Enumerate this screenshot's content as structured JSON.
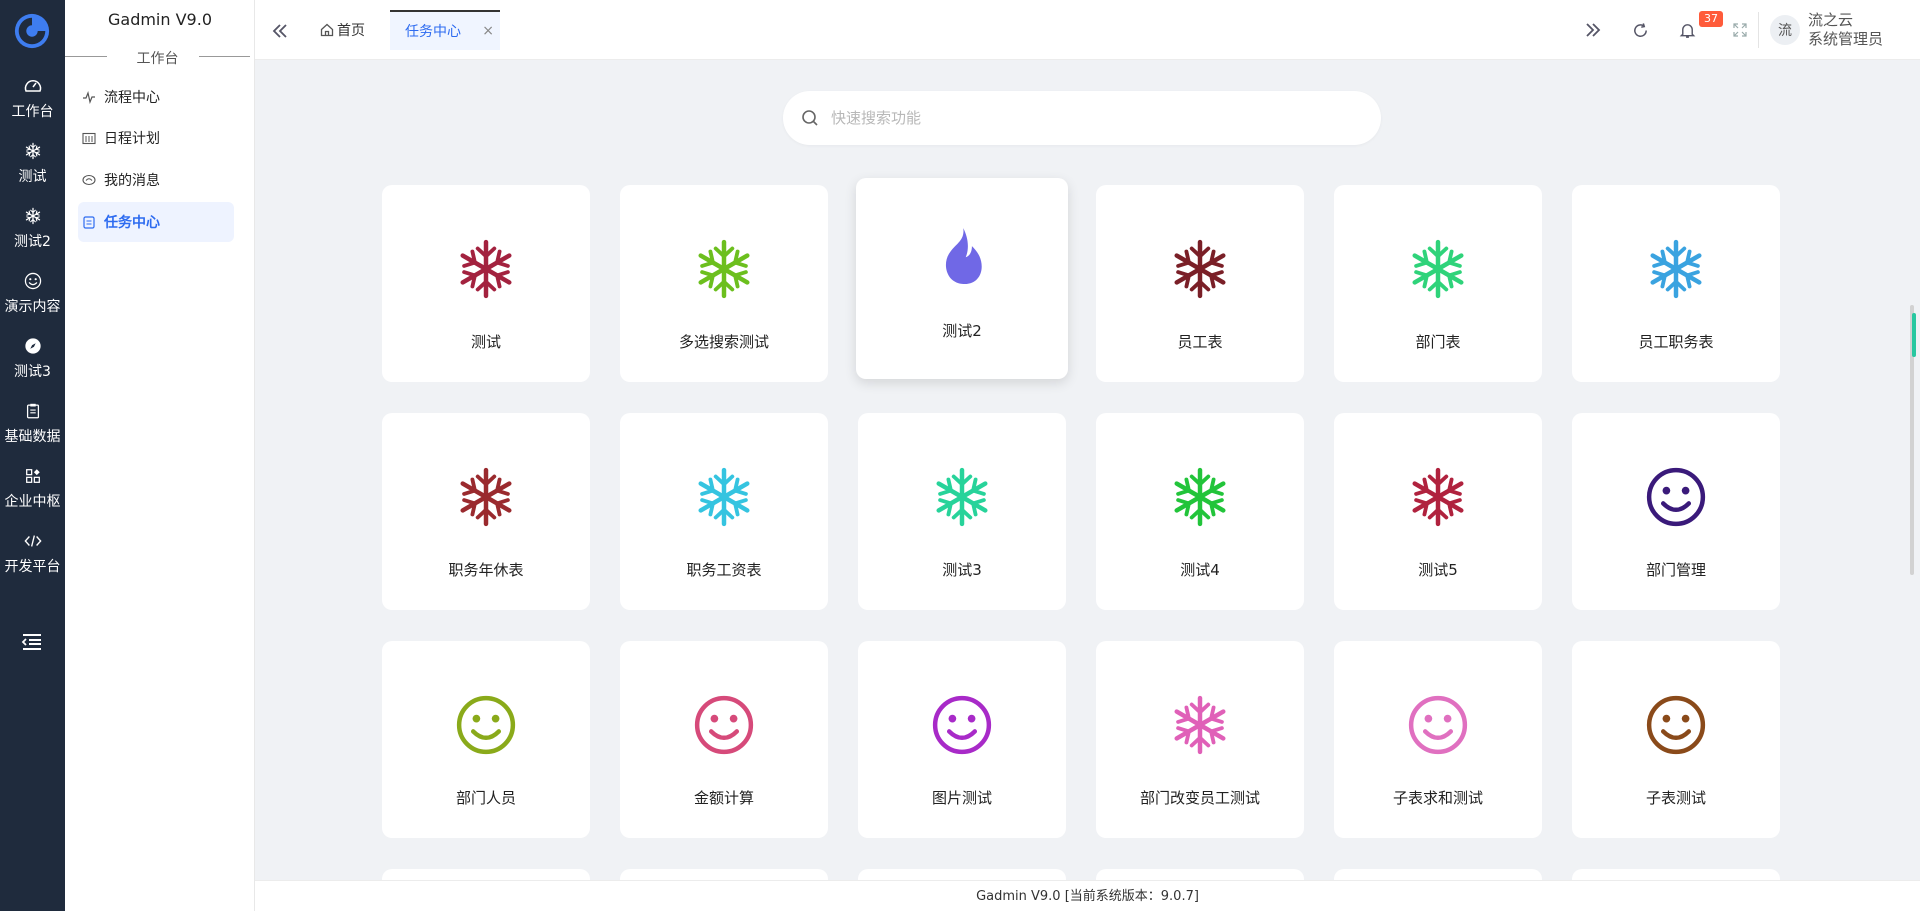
{
  "rail": {
    "items": [
      {
        "label": "工作台",
        "icon": "dashboard-icon"
      },
      {
        "label": "测试",
        "icon": "snowflake-icon"
      },
      {
        "label": "测试2",
        "icon": "snowflake-icon"
      },
      {
        "label": "演示内容",
        "icon": "smile-icon"
      },
      {
        "label": "测试3",
        "icon": "compass-icon"
      },
      {
        "label": "基础数据",
        "icon": "clipboard-icon"
      },
      {
        "label": "企业中枢",
        "icon": "apps-icon"
      },
      {
        "label": "开发平台",
        "icon": "code-icon"
      }
    ]
  },
  "sidebar": {
    "title": "Gadmin V9.0",
    "section": "工作台",
    "items": [
      {
        "label": "流程中心",
        "icon": "pulse-icon"
      },
      {
        "label": "日程计划",
        "icon": "calendar-icon"
      },
      {
        "label": "我的消息",
        "icon": "message-icon"
      },
      {
        "label": "任务中心",
        "icon": "task-icon",
        "active": true
      }
    ]
  },
  "header": {
    "tabs": [
      {
        "label": "首页"
      },
      {
        "label": "任务中心",
        "close": "×"
      }
    ],
    "notification_count": "37",
    "user": {
      "avatar_text": "流",
      "name": "流之云",
      "role": "系统管理员"
    }
  },
  "search": {
    "placeholder": "快速搜索功能"
  },
  "colors": {
    "rail_bg": "#1f2b3d",
    "accent": "#2d6bf0",
    "badge": "#ff5b3a"
  },
  "cards": [
    {
      "label": "测试",
      "icon": "snowflake-icon",
      "color": "#a3223f"
    },
    {
      "label": "多选搜索测试",
      "icon": "snowflake-icon",
      "color": "#6cbf1e"
    },
    {
      "label": "测试2",
      "icon": "fire-icon",
      "color": "#7068e6"
    },
    {
      "label": "员工表",
      "icon": "snowflake-icon",
      "color": "#7a1f27"
    },
    {
      "label": "部门表",
      "icon": "snowflake-icon",
      "color": "#2fd37a"
    },
    {
      "label": "员工职务表",
      "icon": "snowflake-icon",
      "color": "#3aa3e0"
    },
    {
      "label": "职务年休表",
      "icon": "snowflake-icon",
      "color": "#9a2a2e"
    },
    {
      "label": "职务工资表",
      "icon": "snowflake-icon",
      "color": "#35c4e0"
    },
    {
      "label": "测试3",
      "icon": "snowflake-icon",
      "color": "#27d39a"
    },
    {
      "label": "测试4",
      "icon": "snowflake-icon",
      "color": "#22c43a"
    },
    {
      "label": "测试5",
      "icon": "snowflake-icon",
      "color": "#b0223e"
    },
    {
      "label": "部门管理",
      "icon": "smile-icon",
      "color": "#3a1a7a"
    },
    {
      "label": "部门人员",
      "icon": "smile-icon",
      "color": "#8aaa1a"
    },
    {
      "label": "金额计算",
      "icon": "smile-icon",
      "color": "#d64a7a"
    },
    {
      "label": "图片测试",
      "icon": "smile-icon",
      "color": "#a82ac8"
    },
    {
      "label": "部门改变员工测试",
      "icon": "snowflake-icon",
      "color": "#e060b8"
    },
    {
      "label": "子表求和测试",
      "icon": "smile-icon",
      "color": "#e070c0"
    },
    {
      "label": "子表测试",
      "icon": "smile-icon",
      "color": "#8a4a1a"
    }
  ],
  "footer": {
    "text": "Gadmin V9.0 [当前系统版本：9.0.7]"
  }
}
